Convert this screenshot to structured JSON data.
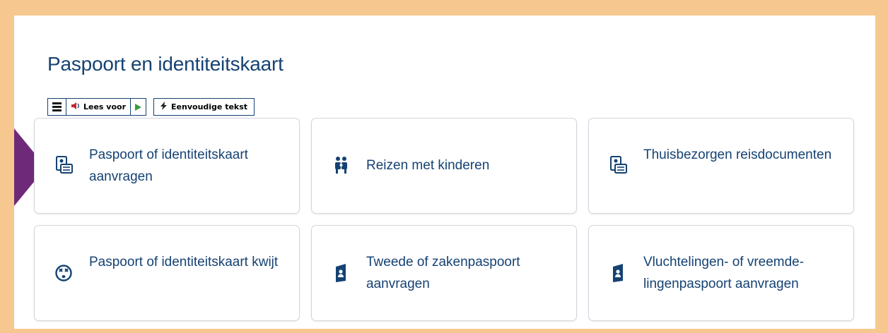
{
  "page": {
    "title": "Paspoort en identiteitskaart"
  },
  "toolbar": {
    "read_aloud_label": "Lees voor",
    "simple_text_label": "Eenvoudige tekst"
  },
  "cards": [
    {
      "label": "Paspoort of identiteitskaart aanvragen",
      "icon": "id-card-icon"
    },
    {
      "label": "Reizen met kinderen",
      "icon": "family-icon"
    },
    {
      "label": "Thuisbezorgen reisdocumenten",
      "icon": "id-card-icon"
    },
    {
      "label": "Paspoort of identiteitskaart kwijt",
      "icon": "lost-face-icon"
    },
    {
      "label": "Tweede of zakenpaspoort aanvragen",
      "icon": "passport-icon"
    },
    {
      "label": "Vluchtelingen- of vreemde-lingenpaspoort aanvragen",
      "icon": "passport-icon"
    }
  ],
  "colors": {
    "frame": "#f6c88f",
    "accent_arrow": "#6e2a78",
    "link_blue": "#154273"
  }
}
